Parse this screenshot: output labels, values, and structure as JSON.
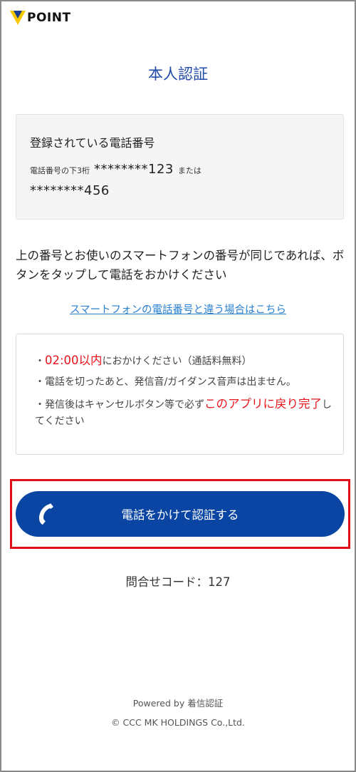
{
  "brand": {
    "logo_text": "POINT"
  },
  "page": {
    "title": "本人認証"
  },
  "registered_phone": {
    "heading": "登録されている電話番号",
    "last_digits_label": "電話番号の下3桁",
    "number_1": "********123",
    "or_label": "または",
    "number_2": "********456"
  },
  "instruction": {
    "text": "上の番号とお使いのスマートフォンの番号が同じであれば、ボタンをタップして電話をおかけください"
  },
  "different_number_link": {
    "label": "スマートフォンの電話番号と違う場合はこちら"
  },
  "notices": {
    "item1_prefix": "・",
    "item1_highlight": "02:00以内",
    "item1_suffix": "におかけください（通話料無料）",
    "item2": "・電話を切ったあと、発信音/ガイダンス音声は出ません。",
    "item3_prefix": "・発信後はキャンセルボタン等で必ず",
    "item3_highlight": "このアプリに戻り完了",
    "item3_suffix": "してください"
  },
  "call_button": {
    "label": "電話をかけて認証する",
    "icon": "phone-handset-icon"
  },
  "inquiry": {
    "text": "問合せコード：127"
  },
  "footer": {
    "powered_by": "Powered by 着信認証",
    "copyright": "© CCC MK HOLDINGS Co.,Ltd."
  },
  "colors": {
    "accent_blue": "#0a45a4",
    "title_blue": "#1f4aa8",
    "link_blue": "#2a7fd0",
    "alert_red": "#e6141b",
    "logo_yellow": "#f5c800"
  }
}
